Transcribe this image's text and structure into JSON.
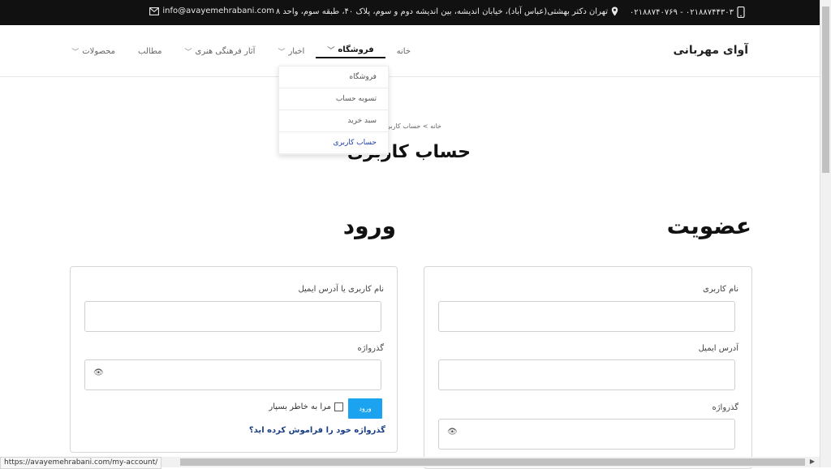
{
  "topbar": {
    "phone": "۰۲۱۸۸۷۴۴۳۰۳ - ۰۲۱۸۸۷۴۰۷۶۹",
    "address": "تهران دکتر بهشتی(عباس آباد)، خیابان اندیشه، بین اندیشه دوم و سوم، پلاک ۴۰، طبقه سوم، واحد ۸",
    "email": "info@avayemehrabani.com"
  },
  "header": {
    "logo": "آوای مهربانی",
    "nav": [
      "خانه",
      "فروشگاه",
      "اخبار",
      "آثار فرهنگی هنری",
      "مطالب",
      "محصولات"
    ]
  },
  "dropdown": {
    "items": [
      "فروشگاه",
      "تسویه حساب",
      "سبد خرید",
      "حساب کاربری"
    ]
  },
  "breadcrumb": "خانه > حساب کاربری",
  "page_title": "حساب کاربری",
  "register": {
    "title": "عضویت",
    "username_label": "نام کاربری",
    "email_label": "آدرس ایمیل",
    "password_label": "گذرواژه"
  },
  "login": {
    "title": "ورود",
    "username_label": "نام کاربری یا آدرس ایمیل",
    "password_label": "گذرواژه",
    "remember_label": "مرا به خاطر بسپار",
    "button_label": "ورود",
    "forgot_label": "گذرواژه خود را فراموش کرده اید؟"
  },
  "status_url": "https://avayemehrabani.com/my-account/",
  "icons": {
    "phone": "phone-icon",
    "location": "location-pin-icon",
    "mail": "mail-icon",
    "eye": "eye-icon"
  },
  "colors": {
    "topbar": "#111111",
    "accent_button": "#1ba3f0",
    "link": "#1a3e86"
  }
}
